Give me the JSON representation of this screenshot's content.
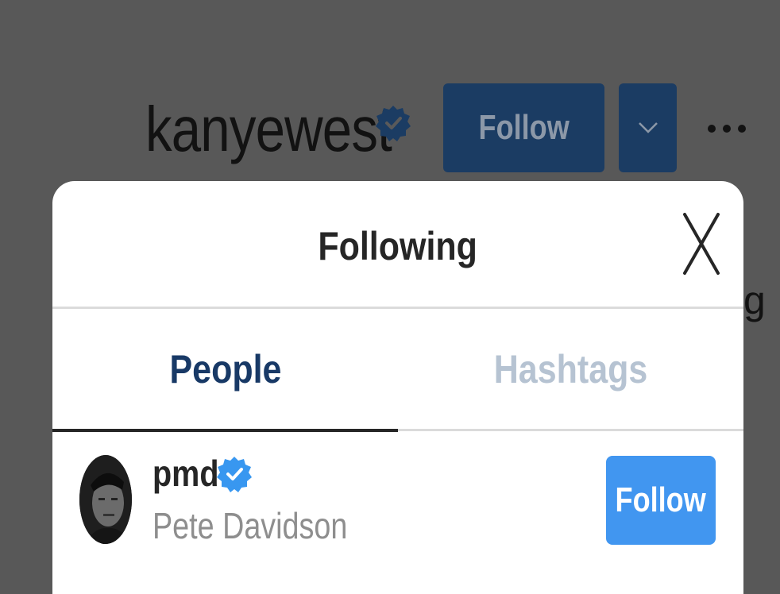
{
  "profile": {
    "username": "kanyewest",
    "follow_label": "Follow",
    "partial_text": "g"
  },
  "modal": {
    "title": "Following",
    "tabs": [
      {
        "label": "People",
        "active": true
      },
      {
        "label": "Hashtags",
        "active": false
      }
    ],
    "users": [
      {
        "username": "pmd",
        "full_name": "Pete Davidson",
        "verified": true,
        "follow_label": "Follow"
      }
    ]
  },
  "colors": {
    "overlay": "#585858",
    "follow_blue": "#4196f0",
    "follow_blue_dimmed": "#1b3c63",
    "active_tab": "#183966",
    "inactive_tab": "#b6c3d2",
    "verified_blue": "#3897f0"
  },
  "icons": {
    "verified": "verified-badge-icon",
    "close": "close-icon",
    "dropdown": "chevron-down-icon",
    "more": "more-options-icon"
  }
}
